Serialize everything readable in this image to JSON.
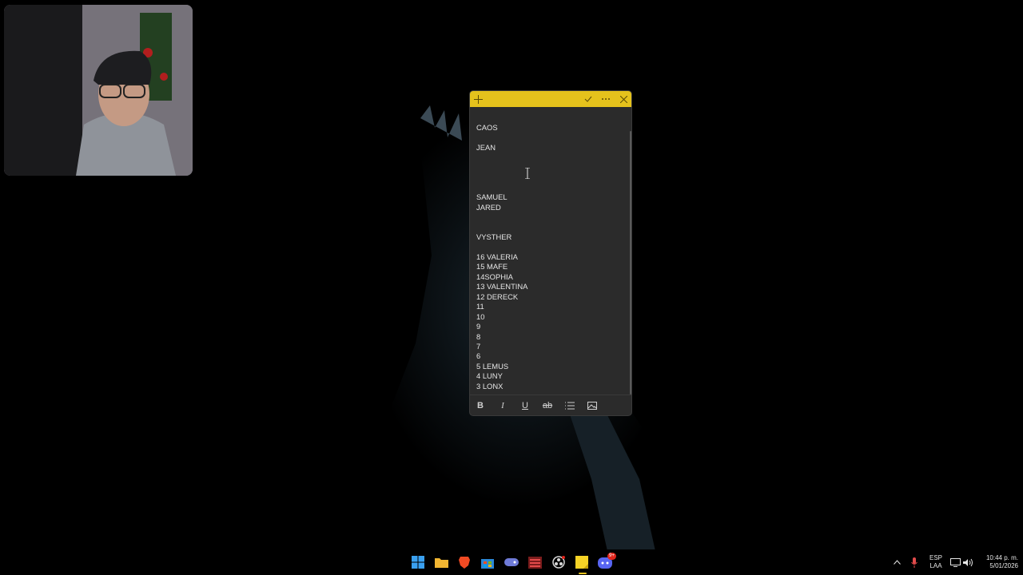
{
  "sticky_note": {
    "toolbar_icons": {
      "new_note": "plus-icon",
      "save": "check-icon",
      "menu": "more-icon",
      "close": "close-icon"
    },
    "text": "CAOS\n\nJEAN\n\n\n\n\nSAMUEL\nJARED\n\n\nVYSTHER\n\n16 VALERIA\n15 MAFE\n14SOPHIA\n13 VALENTINA\n12 DERECK\n11\n10\n9\n8\n7\n6\n5 LEMUS\n4 LUNY\n3 LONX",
    "format_buttons": {
      "bold": "B",
      "italic": "I",
      "underline": "U",
      "strikethrough": "ab"
    },
    "accent_color": "#e5c21c",
    "body_color": "#2b2b2b"
  },
  "taskbar": {
    "apps": [
      "windows-start-icon",
      "file-explorer-icon",
      "brave-browser-icon",
      "microsoft-store-icon",
      "game-controller-icon",
      "media-app-icon",
      "obs-studio-icon",
      "sticky-notes-icon",
      "discord-icon"
    ],
    "discord_badge": "9+",
    "language": "ESP",
    "language_sub": "LAA",
    "time": "10:44 p. m.",
    "date": "5/01/2026"
  }
}
